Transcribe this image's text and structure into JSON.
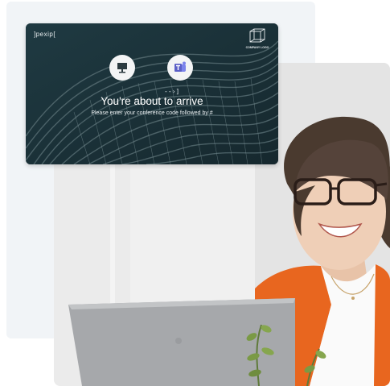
{
  "card": {
    "brand": "]pexip[",
    "company_logo_label": "COMPANY LOGO",
    "title": "You're about to arrive",
    "subtitle": "Please enter your conference code followed by #",
    "icons": [
      "monitor-icon",
      "arrow-right-icon",
      "teams-icon"
    ],
    "colors": {
      "card_bg": "#1c3138",
      "teams_purple": "#5b5fc7",
      "text": "#ffffff"
    }
  },
  "photo": {
    "colors": {
      "background": "#e9e9e9",
      "jacket": "#e8661f",
      "laptop": "#a6a8ab"
    }
  }
}
